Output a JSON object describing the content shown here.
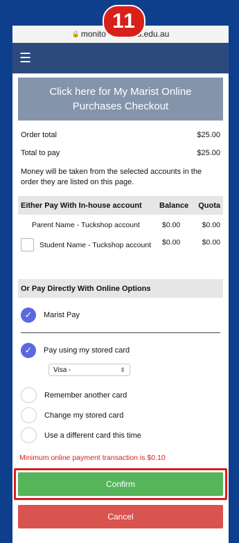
{
  "step_badge": "11",
  "browser": {
    "url": "monito[...]ld.edu.au",
    "url_left": "monito",
    "url_right": "ld.edu.au"
  },
  "nav": {
    "menu_icon": "hamburger-icon"
  },
  "banner": {
    "text": "Click here for My Marist Online Purchases Checkout"
  },
  "summary": {
    "order_total_label": "Order total",
    "order_total_value": "$25.00",
    "total_to_pay_label": "Total to pay",
    "total_to_pay_value": "$25.00",
    "note": "Money will be taken from the selected accounts in the order they are listed on this page."
  },
  "inhouse": {
    "header": "Either Pay With In-house account",
    "col_balance": "Balance",
    "col_quota": "Quota",
    "rows": [
      {
        "name": "Parent Name - Tuckshop account",
        "balance": "$0.00",
        "quota": "$0.00"
      },
      {
        "name": "Student Name - Tuckshop account",
        "balance": "$0.00",
        "quota": "$0.00"
      }
    ]
  },
  "online": {
    "header": "Or Pay Directly With Online Options",
    "marist_pay": "Marist Pay",
    "stored_card": "Pay using my stored card",
    "card_select_value": "Visa -",
    "remember_card": "Remember another card",
    "change_card": "Change my stored card",
    "different_card": "Use a different card this time"
  },
  "min_note": "Minimum online payment transaction is $0.10",
  "actions": {
    "confirm": "Confirm",
    "cancel": "Cancel"
  },
  "colors": {
    "accent": "#5b68e0",
    "confirm": "#56b55a",
    "cancel": "#d9534f",
    "highlight": "#d8201b"
  }
}
